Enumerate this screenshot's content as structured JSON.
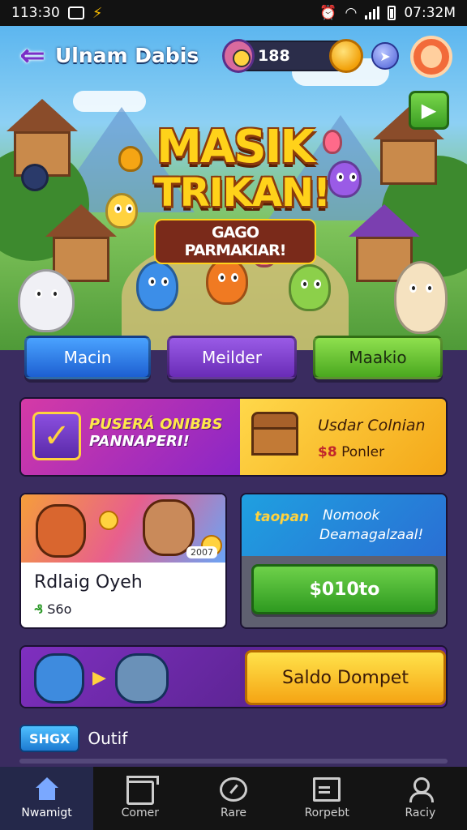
{
  "status_bar": {
    "time": "113:30",
    "clock_right": "07:32M",
    "icons": [
      "screen-icon",
      "bolt-icon",
      "alarm-icon",
      "wifi-icon",
      "signal-icon",
      "battery-icon"
    ]
  },
  "header": {
    "title": "Ulnam Dabis",
    "coin_balance": "188"
  },
  "hero": {
    "logo_line1": "MASIK",
    "logo_line2": "TRIKAN!",
    "logo_sub": "GAGO PARMAKIAR!"
  },
  "modes": [
    {
      "label": "Macin"
    },
    {
      "label": "Meilder"
    },
    {
      "label": "Maakio"
    }
  ],
  "promo": {
    "title_line1": "PUSERÁ ONIBBS",
    "title_line2": "PANNAPERI!",
    "right_title": "Usdar Colnian",
    "right_price_symbol": "$8",
    "right_price_text": "Ponler"
  },
  "game_card": {
    "tag": "2007",
    "name": "Rdlaig Oyeh",
    "price_symbol": "₰",
    "price": "S6o"
  },
  "pay_card": {
    "label_a": "taopan",
    "label_b": "Nomook",
    "label_c": "Deamagalzaal!",
    "button": "$010to"
  },
  "wallet": {
    "button": "Saldo Dompet"
  },
  "section": {
    "badge": "SHGX",
    "label": "Outif"
  },
  "bottom_nav": [
    {
      "label": "Nwamigt",
      "icon": "home-icon",
      "active": true
    },
    {
      "label": "Comer",
      "icon": "store-icon",
      "active": false
    },
    {
      "label": "Rare",
      "icon": "gauge-icon",
      "active": false
    },
    {
      "label": "Rorpebt",
      "icon": "document-icon",
      "active": false
    },
    {
      "label": "Raciy",
      "icon": "user-icon",
      "active": false
    }
  ],
  "colors": {
    "background": "#3a2c60",
    "accent_gold": "#ffd21a",
    "button_green": "#3b9e24",
    "button_blue": "#1d5fd1",
    "button_purple": "#6a2cb7",
    "nav_bg": "#141414"
  }
}
